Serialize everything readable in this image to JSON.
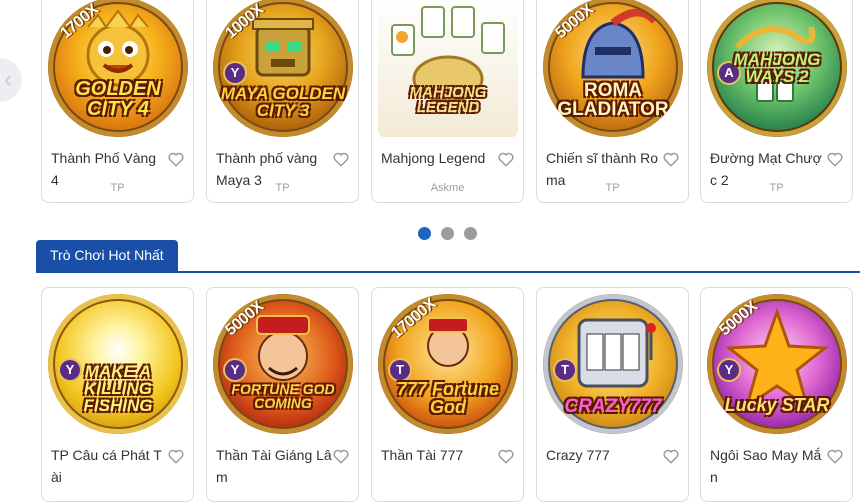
{
  "carousel": {
    "cards": [
      {
        "name": "Thành Phố Vàng 4",
        "provider": "TP",
        "mult": "1700X",
        "badge": "",
        "logo": "GOLDEN CITY 4"
      },
      {
        "name": "Thành phố vàng Maya 3",
        "provider": "TP",
        "mult": "1000X",
        "badge": "Y",
        "logo": "MAYA GOLDEN CITY 3"
      },
      {
        "name": "Mahjong Legend",
        "provider": "Askme",
        "mult": "",
        "badge": "",
        "logo": "MAHJONG LEGEND"
      },
      {
        "name": "Chiến sĩ thành Roma",
        "provider": "TP",
        "mult": "5000X",
        "badge": "",
        "logo": "ROMA GLADIATOR"
      },
      {
        "name": "Đường Mạt Chược 2",
        "provider": "TP",
        "mult": "",
        "badge": "A",
        "logo": "MAHJONG WAYS 2"
      }
    ],
    "dots_count": 3,
    "active_dot": 0,
    "prev_arrow": "‹"
  },
  "section": {
    "title": "Trò Chơi Hot Nhất"
  },
  "hot_games": [
    {
      "name": "TP Câu cá Phát Tài",
      "mult": "",
      "badge": "Y",
      "logo": "MAKE A KILLING FISHING"
    },
    {
      "name": "Thần Tài Giáng Lâm",
      "mult": "5000X",
      "badge": "Y",
      "logo": "FORTUNE GOD COMING"
    },
    {
      "name": "Thần Tài 777",
      "mult": "17000X",
      "badge": "T",
      "logo": "777 Fortune God"
    },
    {
      "name": "Crazy 777",
      "mult": "",
      "badge": "T",
      "logo": "CRAZY777"
    },
    {
      "name": "Ngôi Sao May Mắn",
      "mult": "5000X",
      "badge": "Y",
      "logo": "Lucky STAR"
    }
  ],
  "icons": {
    "favorite": "heart-outline-icon",
    "prev": "chevron-left-icon"
  },
  "colors": {
    "accent": "#1a4fa8",
    "dot_active": "#1f64c4",
    "dot_inactive": "#9c9c9c"
  }
}
